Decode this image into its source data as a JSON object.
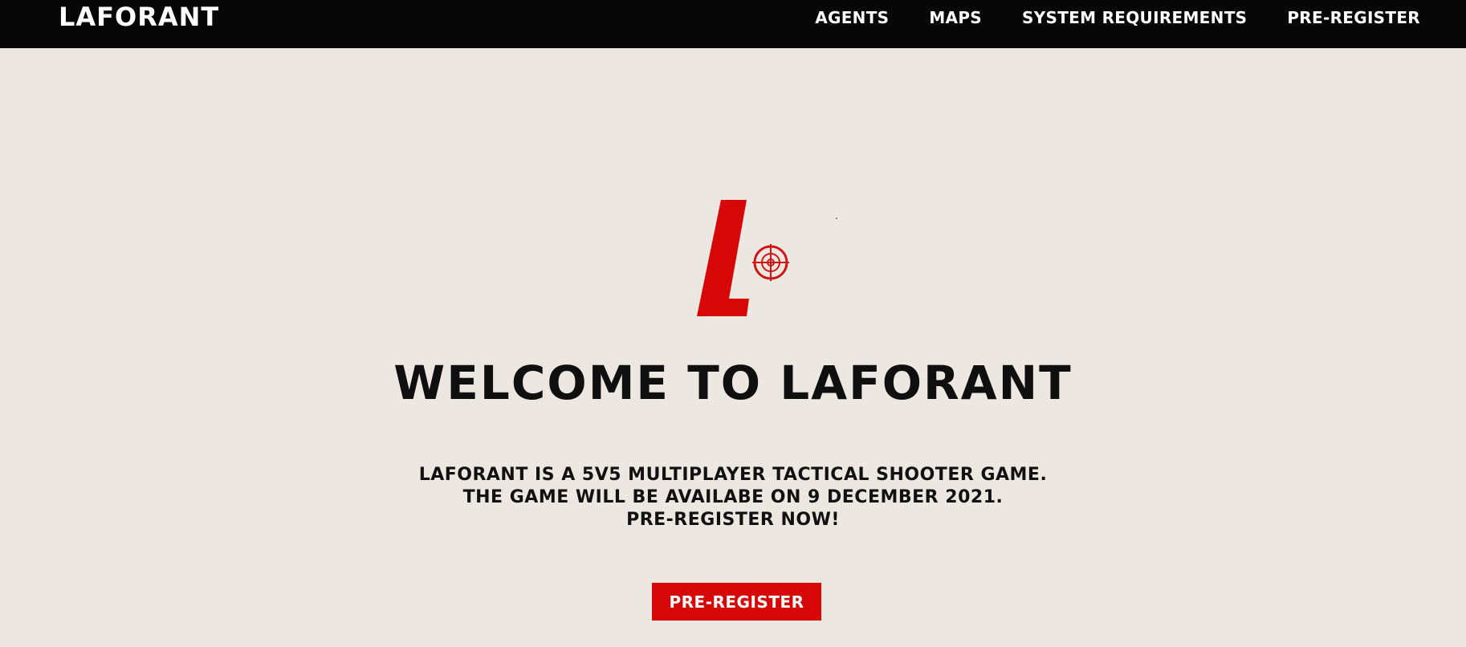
{
  "brand": "LAFORANT",
  "nav": {
    "links": [
      "AGENTS",
      "MAPS",
      "SYSTEM REQUIREMENTS",
      "PRE-REGISTER"
    ]
  },
  "hero": {
    "logo_icon": "laforant-logo-with-crosshair",
    "title": "WELCOME TO LAFORANT",
    "description": [
      "LAFORANT IS A 5V5 MULTIPLAYER TACTICAL SHOOTER GAME.",
      "THE GAME WILL BE AVAILABE ON 9 DECEMBER 2021.",
      "PRE-REGISTER NOW!"
    ],
    "cta_label": "PRE-REGISTER"
  },
  "colors": {
    "background": "#ece8e1",
    "navbar": "#070707",
    "accent": "#d50707",
    "text": "#0f0f0f"
  }
}
